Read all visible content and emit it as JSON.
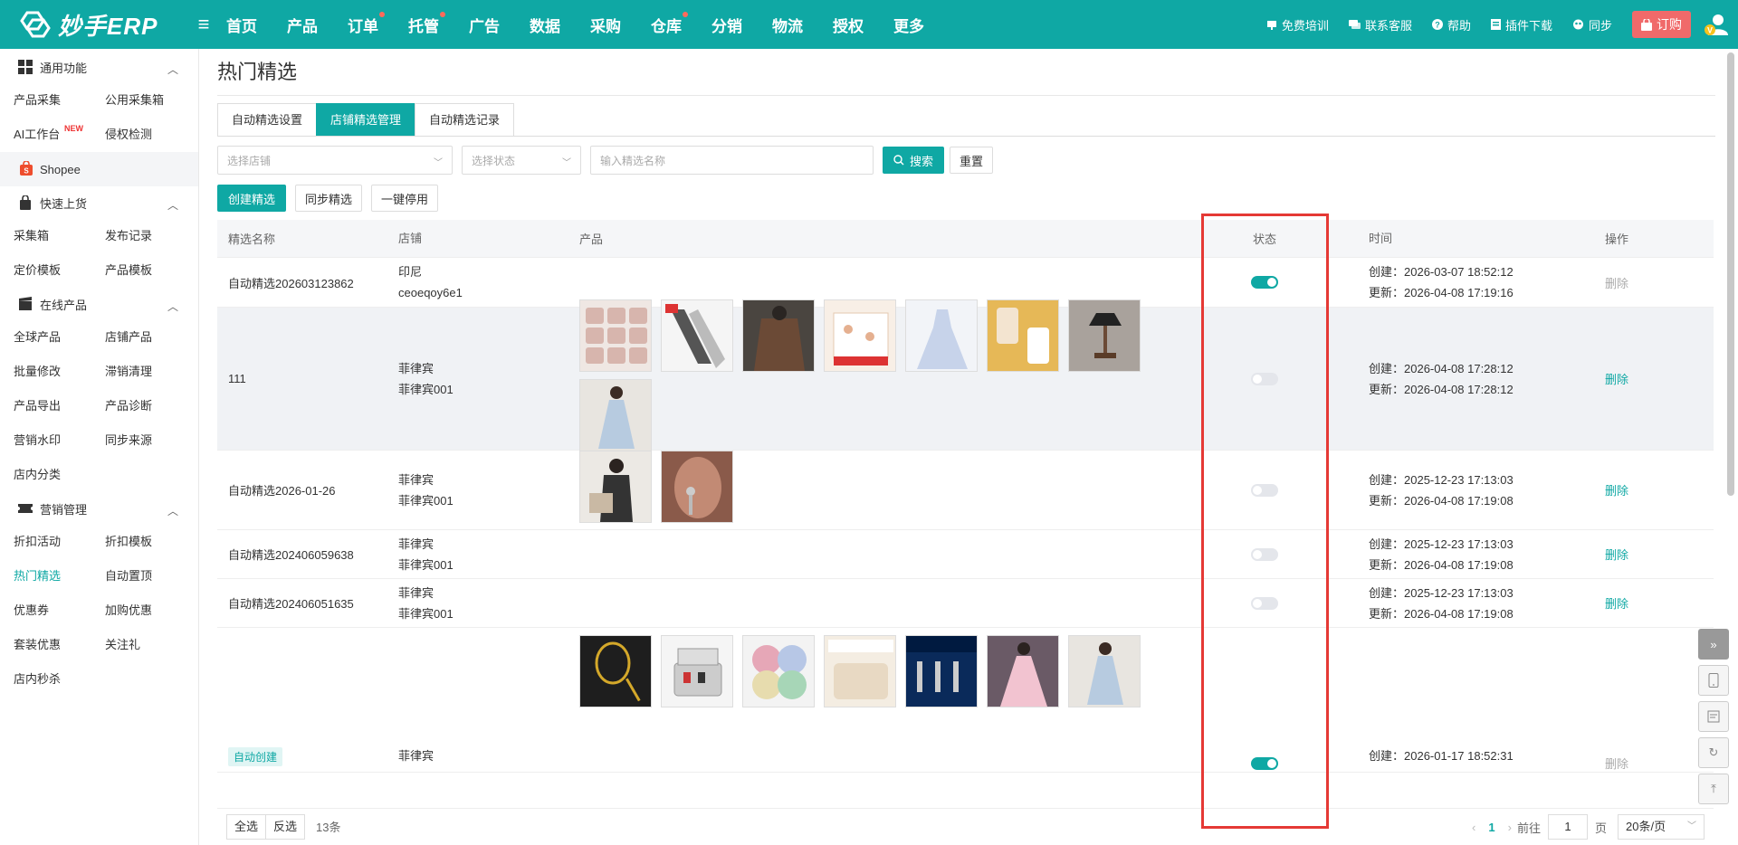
{
  "app": {
    "logo": "妙手ERP"
  },
  "nav": [
    {
      "label": "首页",
      "dot": false
    },
    {
      "label": "产品",
      "dot": false
    },
    {
      "label": "订单",
      "dot": true
    },
    {
      "label": "托管",
      "dot": true
    },
    {
      "label": "广告",
      "dot": false
    },
    {
      "label": "数据",
      "dot": false
    },
    {
      "label": "采购",
      "dot": false
    },
    {
      "label": "仓库",
      "dot": true
    },
    {
      "label": "分销",
      "dot": false
    },
    {
      "label": "物流",
      "dot": false
    },
    {
      "label": "授权",
      "dot": false
    },
    {
      "label": "更多",
      "dot": false
    }
  ],
  "top_right": {
    "training": "免费培训",
    "support": "联系客服",
    "help": "帮助",
    "plugin": "插件下载",
    "sync": "同步",
    "order": "订购"
  },
  "sidebar": {
    "general": {
      "title": "通用功能",
      "items": [
        "产品采集",
        "公用采集箱",
        "AI工作台",
        "侵权检测"
      ],
      "new_badge": "NEW"
    },
    "platform": "Shopee",
    "quick": {
      "title": "快速上货",
      "items": [
        "采集箱",
        "发布记录",
        "定价模板",
        "产品模板"
      ]
    },
    "online": {
      "title": "在线产品",
      "items": [
        "全球产品",
        "店铺产品",
        "批量修改",
        "滞销清理",
        "产品导出",
        "产品诊断",
        "营销水印",
        "同步来源",
        "店内分类"
      ]
    },
    "marketing": {
      "title": "营销管理",
      "items": [
        "折扣活动",
        "折扣模板",
        "热门精选",
        "自动置顶",
        "优惠券",
        "加购优惠",
        "套装优惠",
        "关注礼",
        "店内秒杀"
      ]
    }
  },
  "page": {
    "title": "热门精选",
    "tabs": [
      "自动精选设置",
      "店铺精选管理",
      "自动精选记录"
    ],
    "active_tab": 1,
    "filters": {
      "shop_placeholder": "选择店铺",
      "status_placeholder": "选择状态",
      "name_placeholder": "输入精选名称",
      "search": "搜索",
      "reset": "重置"
    },
    "actions": [
      "创建精选",
      "同步精选",
      "一键停用"
    ]
  },
  "table": {
    "headers": [
      "精选名称",
      "店铺",
      "产品",
      "状态",
      "时间",
      "操作"
    ],
    "rows": [
      {
        "name": "自动精选202603123862",
        "shop1": "印尼",
        "shop2": "ceoeqoy6e1",
        "products": [],
        "status": true,
        "created": "创建：2026-03-07 18:52:12",
        "updated": "更新：2026-04-08 17:19:16",
        "action": "删除",
        "action_disabled": true
      },
      {
        "name": "111",
        "shop1": "菲律宾",
        "shop2": "菲律宾001",
        "products": [
          "yarn",
          "scarf",
          "coat",
          "textile-package",
          "wedding-dress",
          "phone-case",
          "table-lamp",
          "blue-dress"
        ],
        "status": false,
        "created": "创建：2026-04-08 17:28:12",
        "updated": "更新：2026-04-08 17:28:12",
        "action": "删除",
        "action_disabled": false
      },
      {
        "name": "自动精选2026-01-26",
        "shop1": "菲律宾",
        "shop2": "菲律宾001",
        "products": [
          "handbag-model",
          "earrings"
        ],
        "status": false,
        "created": "创建：2025-12-23 17:13:03",
        "updated": "更新：2026-04-08 17:19:08",
        "action": "删除",
        "action_disabled": false
      },
      {
        "name": "自动精选202406059638",
        "shop1": "菲律宾",
        "shop2": "菲律宾001",
        "products": [],
        "status": false,
        "created": "创建：2025-12-23 17:13:03",
        "updated": "更新：2026-04-08 17:19:08",
        "action": "删除",
        "action_disabled": false
      },
      {
        "name": "自动精选202406051635",
        "shop1": "菲律宾",
        "shop2": "菲律宾001",
        "products": [],
        "status": false,
        "created": "创建：2025-12-23 17:13:03",
        "updated": "更新：2026-04-08 17:19:08",
        "action": "删除",
        "action_disabled": false
      },
      {
        "name": "",
        "tag": "自动创建",
        "shop1": "菲律宾",
        "shop2": "",
        "products": [
          "badminton-racket",
          "cosmetic-case",
          "bath-sponges",
          "blanket",
          "water-pipe",
          "pink-gown",
          "blue-dress"
        ],
        "status": true,
        "created": "创建：2026-01-17 18:52:31",
        "updated": "",
        "action": "删除",
        "action_disabled": true
      }
    ]
  },
  "footer": {
    "select_all": "全选",
    "invert": "反选",
    "count": "13条",
    "page": "1",
    "goto": "前往",
    "goto_value": "1",
    "page_unit": "页",
    "page_size": "20条/页"
  },
  "colors": {
    "primary": "#0fa8a4",
    "highlight": "#e53935",
    "order": "#f06a6a"
  }
}
